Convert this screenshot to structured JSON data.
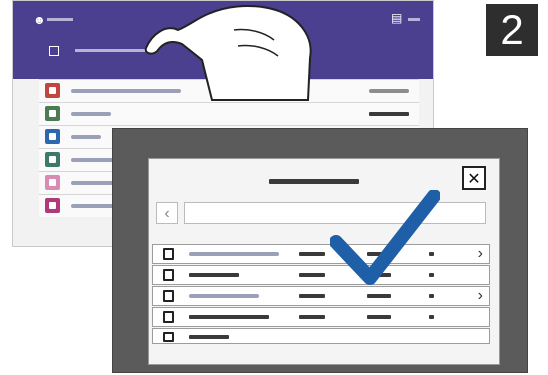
{
  "step_number": "2",
  "dialog": {
    "close_glyph": "✕",
    "back_glyph": "‹"
  },
  "colors": {
    "header": "#4b3f8f",
    "check": "#1f5fa8",
    "overlay": "#5b5b5b"
  },
  "app_list": [
    {
      "icon": "red-app-icon",
      "color": "#c0463f"
    },
    {
      "icon": "green-app-icon",
      "color": "#4c7a52"
    },
    {
      "icon": "blue-app-icon",
      "color": "#2c67b3"
    },
    {
      "icon": "teal-app-icon",
      "color": "#3e7a6a"
    },
    {
      "icon": "pinwheel-app-icon",
      "color": "#d98bb3"
    },
    {
      "icon": "magenta-app-icon",
      "color": "#b03a77"
    }
  ],
  "file_rows": [
    {
      "icon": "folder-icon",
      "has_chevron": true,
      "chevron": "›"
    },
    {
      "icon": "document-icon",
      "has_chevron": false,
      "chevron": ""
    },
    {
      "icon": "folder-icon",
      "has_chevron": true,
      "chevron": "›"
    },
    {
      "icon": "document-icon",
      "has_chevron": false,
      "chevron": ""
    },
    {
      "icon": "document-icon",
      "has_chevron": false,
      "chevron": ""
    }
  ]
}
